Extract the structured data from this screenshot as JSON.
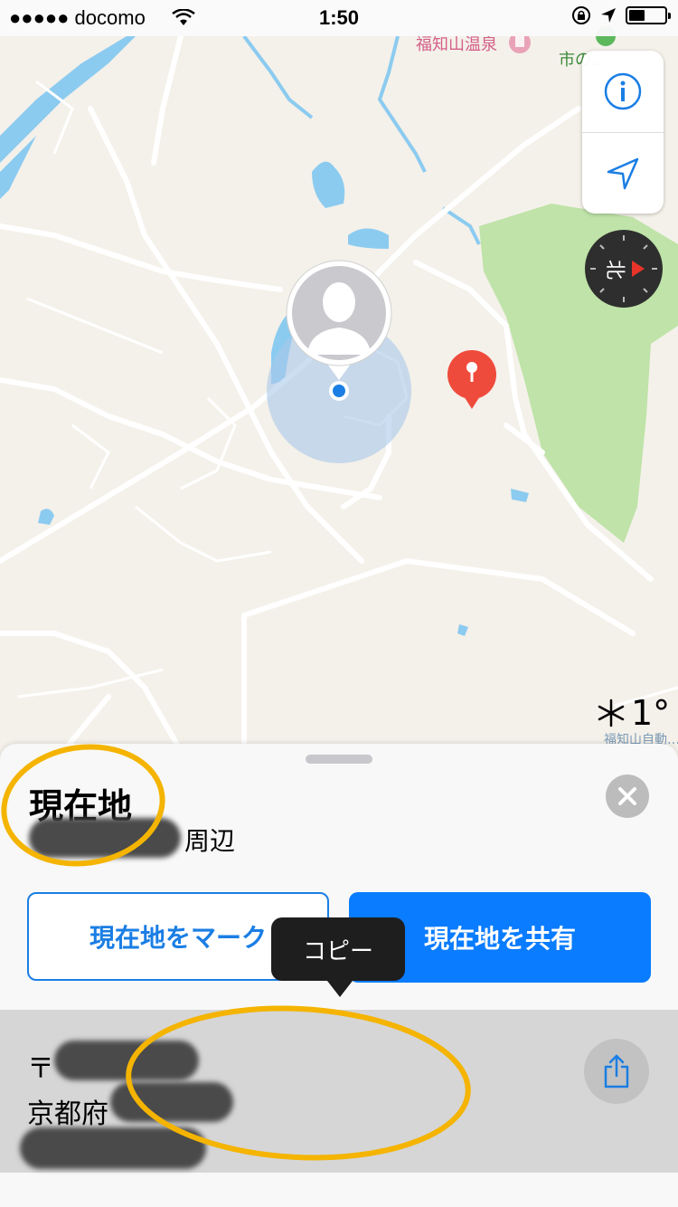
{
  "status_bar": {
    "carrier": "●●●●● docomo",
    "time": "1:50"
  },
  "map": {
    "poi_label": "福知山温泉",
    "park_label": "市の…",
    "bottom_label": "福知山自動…",
    "colors": {
      "land": "#f4f1ea",
      "road": "#ffffff",
      "water": "#8ccbf0",
      "park": "#bfe3a8",
      "accuracy": "#a9c8ea",
      "pin": "#ef4b3c"
    }
  },
  "controls": {
    "info_icon": "info-icon",
    "location_icon": "location-arrow-icon",
    "compass_label": "北"
  },
  "weather": {
    "icon": "snowflake-icon",
    "temp": "1°"
  },
  "sheet": {
    "title": "現在地",
    "subtitle": "周辺",
    "mark_button": "現在地をマーク",
    "share_button": "現在地を共有",
    "address_line1": "〒",
    "address_line2": "京都府"
  },
  "tooltip": {
    "label": "コピー"
  },
  "accent": "#0a7cff",
  "annotation_color": "#f4b400"
}
